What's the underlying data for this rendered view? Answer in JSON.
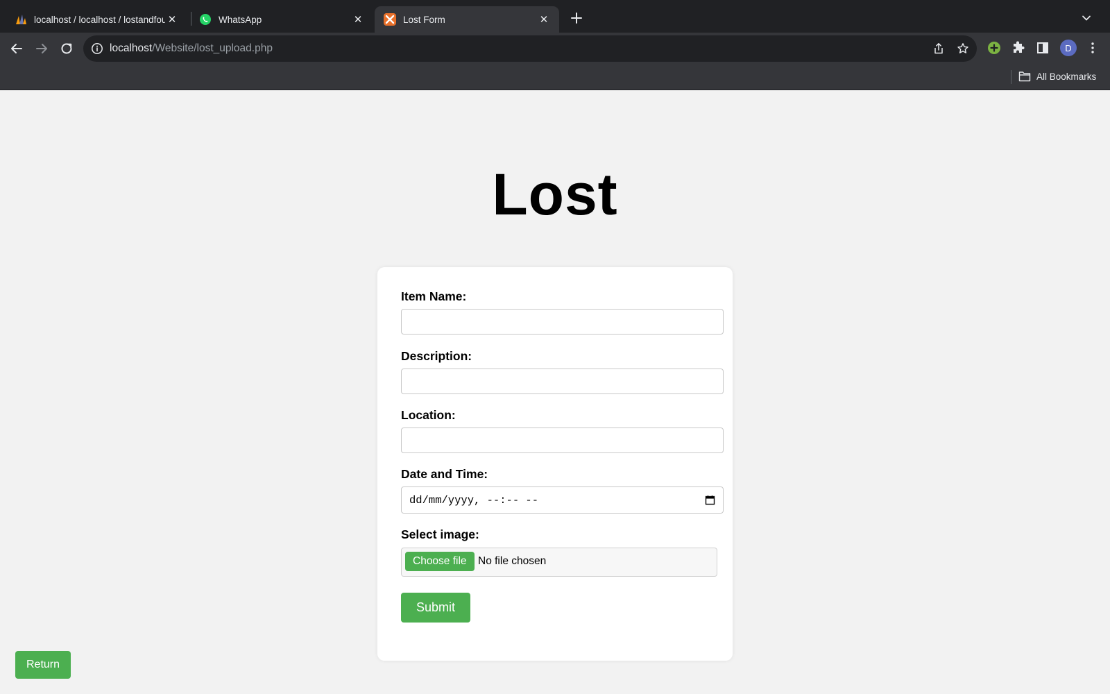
{
  "browser": {
    "tabs": [
      {
        "title": "localhost / localhost / lostandfound",
        "favicon": "phpmyadmin-icon",
        "active": false
      },
      {
        "title": "WhatsApp",
        "favicon": "whatsapp-icon",
        "active": false
      },
      {
        "title": "Lost Form",
        "favicon": "xampp-icon",
        "active": true
      }
    ],
    "url_host": "localhost",
    "url_path": "/Website/lost_upload.php",
    "profile_initial": "D",
    "bookmarks_label": "All Bookmarks",
    "colors": {
      "tabstrip": "#202124",
      "toolbar": "#35363a",
      "omnibox": "#202124"
    }
  },
  "page": {
    "title": "Lost",
    "form": {
      "item_name_label": "Item Name:",
      "item_name_value": "",
      "description_label": "Description:",
      "description_value": "",
      "location_label": "Location:",
      "location_value": "",
      "datetime_label": "Date and Time:",
      "datetime_placeholder": "dd/mm/yyyy, --:-- --",
      "image_label": "Select image:",
      "choose_file_label": "Choose file",
      "no_file_text": "No file chosen",
      "submit_label": "Submit"
    },
    "return_label": "Return",
    "colors": {
      "accent": "#4caf50",
      "background": "#f2f2f2",
      "card": "#ffffff"
    }
  }
}
